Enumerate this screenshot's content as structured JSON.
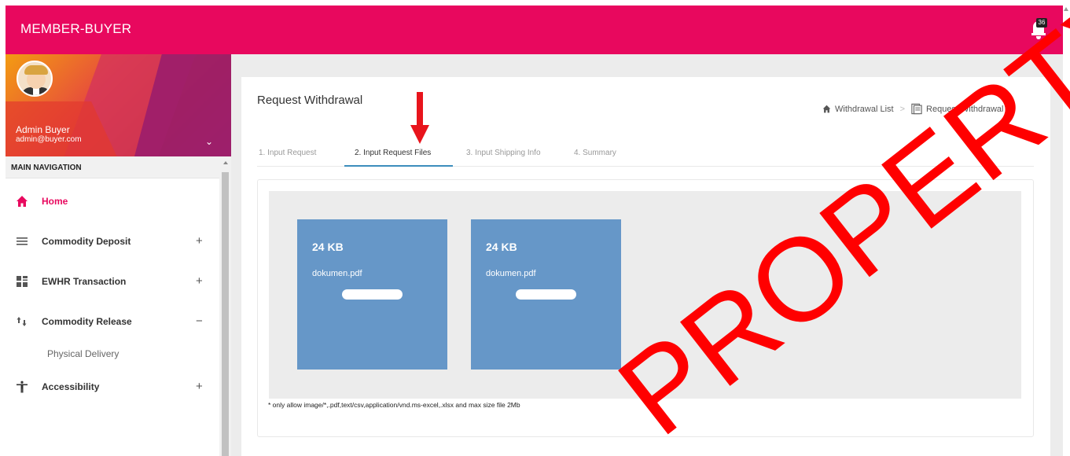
{
  "header": {
    "brand": "MEMBER-BUYER",
    "notification_count": "36",
    "accent_color": "#e8085e"
  },
  "sidebar": {
    "user": {
      "name": "Admin Buyer",
      "email": "admin@buyer.com"
    },
    "nav_header": "MAIN NAVIGATION",
    "items": [
      {
        "label": "Home",
        "icon": "home-icon",
        "active": true
      },
      {
        "label": "Commodity Deposit",
        "icon": "list-icon",
        "toggle": "+"
      },
      {
        "label": "EWHR Transaction",
        "icon": "grid-icon",
        "toggle": "+"
      },
      {
        "label": "Commodity Release",
        "icon": "sort-arrows-icon",
        "toggle": "−",
        "children": [
          {
            "label": "Physical Delivery"
          }
        ]
      },
      {
        "label": "Accessibility",
        "icon": "accessibility-icon",
        "toggle": "+"
      }
    ]
  },
  "main": {
    "title": "Request Withdrawal",
    "breadcrumb": [
      {
        "label": "Withdrawal List",
        "icon": "home-icon"
      },
      {
        "label": "Request Withdrawal",
        "icon": "document-icon"
      }
    ],
    "tabs": [
      {
        "label": "1. Input Request"
      },
      {
        "label": "2. Input Request Files",
        "active": true
      },
      {
        "label": "3. Input Shipping Info"
      },
      {
        "label": "4. Summary"
      }
    ],
    "files": [
      {
        "size": "24 KB",
        "name": "dokumen.pdf",
        "progress": 1.0
      },
      {
        "size": "24 KB",
        "name": "dokumen.pdf",
        "progress": 1.0
      }
    ],
    "note": "* only allow image/*,.pdf,text/csv,application/vnd.ms-excel,.xlsx and max size file 2Mb"
  },
  "watermark": "PROPERTY",
  "annotation_color": "#e8141c"
}
